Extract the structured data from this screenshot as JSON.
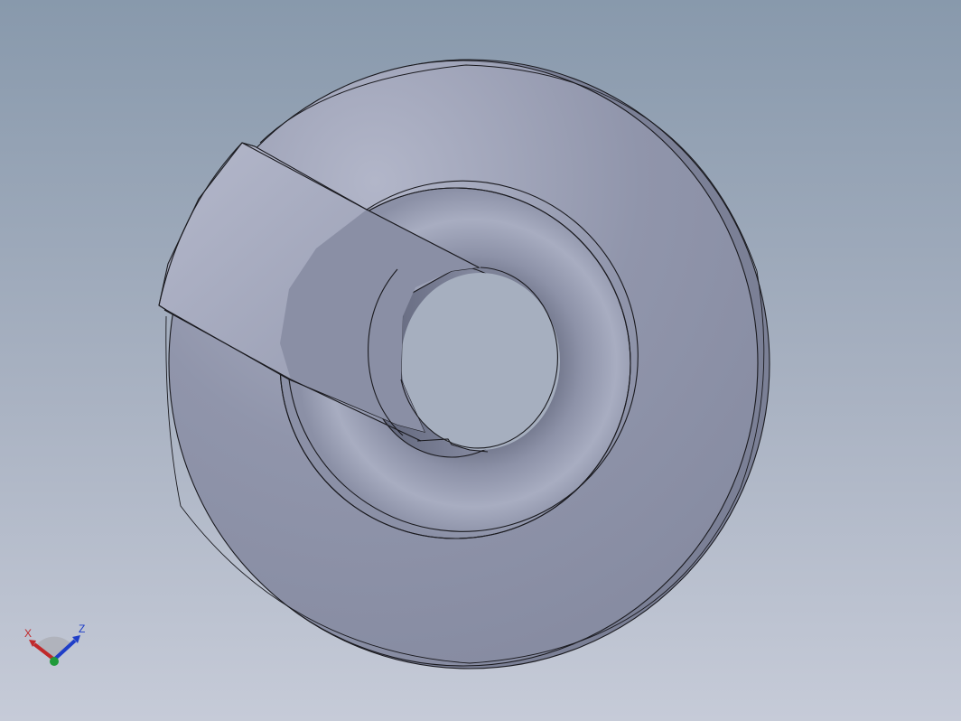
{
  "viewport": {
    "background_top": "#8a9aae",
    "background_bottom": "#c4c9d6",
    "model_face_color": "#8f95ab",
    "model_highlight_color": "#b3b7ca",
    "edge_color": "#1a1a1f"
  },
  "triad": {
    "x_label": "X",
    "z_label": "Z",
    "x_color": "#c0282a",
    "y_color": "#1f9a3a",
    "z_color": "#1f3ec8"
  }
}
